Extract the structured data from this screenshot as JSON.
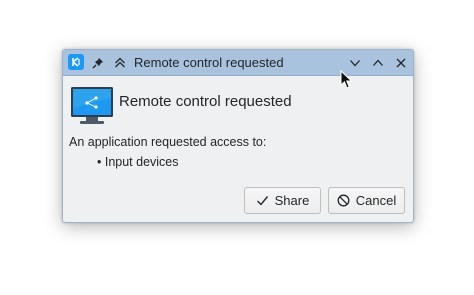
{
  "window": {
    "title": "Remote control requested",
    "icons": {
      "app": "kde-logo-icon",
      "pin": "pin-icon",
      "keep_above": "keep-above-icon",
      "minimize": "chevron-down-icon",
      "maximize": "chevron-up-icon",
      "close": "close-icon"
    },
    "colors": {
      "titlebar": "#a9c3de",
      "background": "#eff0f1",
      "accent": "#1d99f3"
    }
  },
  "dialog": {
    "icon": "monitor-remote-icon",
    "heading": "Remote control requested",
    "message": "An application requested access to:",
    "items": [
      "• Input devices"
    ]
  },
  "buttons": {
    "share_label": "Share",
    "share_icon": "checkmark-icon",
    "cancel_label": "Cancel",
    "cancel_icon": "cancel-icon"
  }
}
